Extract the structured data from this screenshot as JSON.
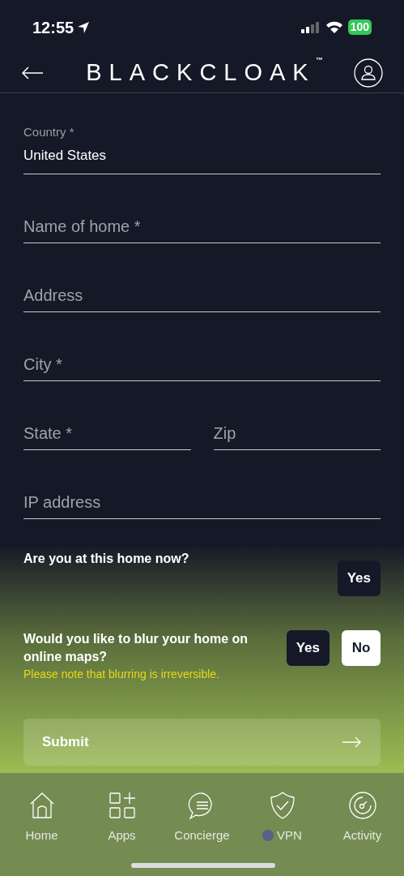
{
  "status_bar": {
    "time": "12:55",
    "battery": "100"
  },
  "header": {
    "logo": "BLACKCLOAK",
    "trademark": "™"
  },
  "form_rows": [
    [
      {
        "label": "Country *",
        "value": "United States"
      }
    ],
    [
      {
        "placeholder": "Name of home *"
      }
    ],
    [
      {
        "placeholder": "Address"
      }
    ],
    [
      {
        "placeholder": "City *"
      }
    ],
    [
      {
        "placeholder": "State *"
      },
      {
        "placeholder": "Zip"
      }
    ],
    [
      {
        "placeholder": "IP address"
      }
    ]
  ],
  "questions": [
    {
      "text": "Are you at this home now?",
      "buttons": [
        {
          "label": "Yes",
          "selected": false
        }
      ]
    },
    {
      "text": "Would you like to blur your home on online maps?",
      "note": "Please note that blurring is irreversible.",
      "buttons": [
        {
          "label": "Yes",
          "selected": false
        },
        {
          "label": "No",
          "selected": true
        }
      ]
    }
  ],
  "submit": "Submit",
  "tab_bar": [
    {
      "kind": "home",
      "label": "Home"
    },
    {
      "kind": "apps",
      "label": "Apps"
    },
    {
      "kind": "chat",
      "label": "Concierge"
    },
    {
      "kind": "shield",
      "label": "VPN",
      "color": "#5a5f8a"
    },
    {
      "kind": "gauge",
      "label": "Activity"
    }
  ]
}
